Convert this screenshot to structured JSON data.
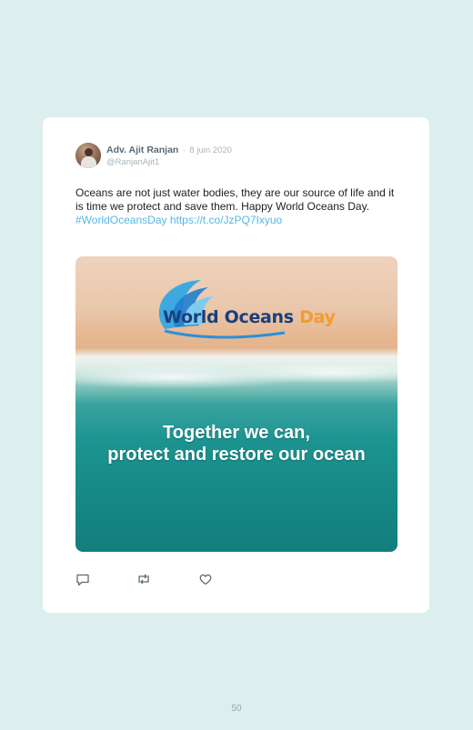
{
  "tweet": {
    "author_name": "Adv. Ajit Ranjan",
    "separator": "·",
    "date": "8 juin 2020",
    "handle": "@RanjanAjit1",
    "text": "Oceans are not just water bodies, they are our source of life and it is time we protect and save them. Happy World Oceans Day.",
    "hashtag": "#WorldOceansDay",
    "link": "https://t.co/JzPQ7Ixyuo"
  },
  "media": {
    "logo_text_main": "World Oceans ",
    "logo_text_accent": "Day",
    "overlay_line1": "Together we  can,",
    "overlay_line2": "protect and restore our ocean"
  },
  "actions": {
    "reply_icon": "reply-icon",
    "retweet_icon": "retweet-icon",
    "like_icon": "heart-icon"
  },
  "colors": {
    "background": "#dcefee",
    "link": "#56b6e6",
    "logo_blue": "#1b3f7a",
    "logo_orange": "#f29b2f"
  },
  "page": {
    "number": "50"
  }
}
